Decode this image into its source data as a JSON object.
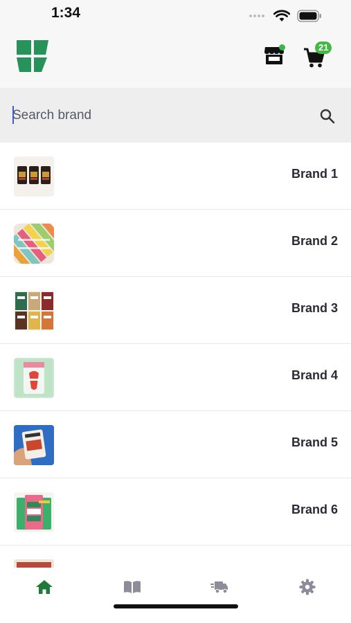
{
  "status_bar": {
    "time": "1:34"
  },
  "header": {
    "cart_count": "21",
    "logo_icon": "brand-logo-green",
    "store_icon": "store-icon",
    "cart_icon": "cart-icon"
  },
  "search": {
    "placeholder": "Search brand"
  },
  "brands": [
    {
      "name": "Brand 1",
      "thumb": "three-dark-jars"
    },
    {
      "name": "Brand 2",
      "thumb": "colorful-bars-pattern"
    },
    {
      "name": "Brand 3",
      "thumb": "six-snack-bars-grid"
    },
    {
      "name": "Brand 4",
      "thumb": "green-pouch"
    },
    {
      "name": "Brand 5",
      "thumb": "hand-holding-pack"
    },
    {
      "name": "Brand 6",
      "thumb": "pink-green-packs"
    },
    {
      "name": "",
      "thumb": "partial-product"
    }
  ],
  "bottom_nav": [
    {
      "name": "home",
      "icon": "home-icon",
      "active": true
    },
    {
      "name": "catalog",
      "icon": "book-icon",
      "active": false
    },
    {
      "name": "orders",
      "icon": "truck-icon",
      "active": false
    },
    {
      "name": "settings",
      "icon": "gear-icon",
      "active": false
    }
  ],
  "colors": {
    "accent": "#1f7a3a",
    "badge": "#43b943",
    "nav_inactive": "#8c8d98"
  }
}
